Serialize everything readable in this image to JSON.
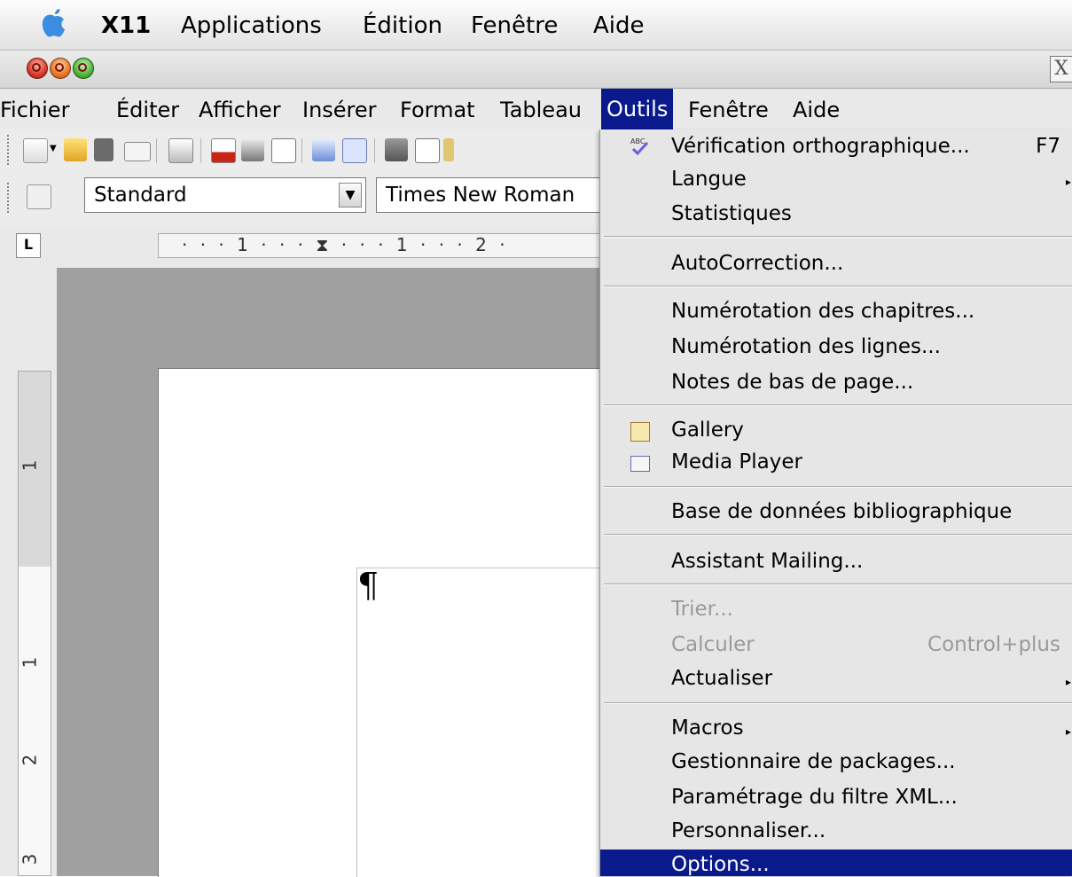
{
  "mac_menubar": {
    "items": [
      "X11",
      "Applications",
      "Édition",
      "Fenêtre",
      "Aide"
    ]
  },
  "window": {
    "close_glyph": "X"
  },
  "app_menubar": {
    "items": [
      "Fichier",
      "Éditer",
      "Afficher",
      "Insérer",
      "Format",
      "Tableau",
      "Outils",
      "Fenêtre",
      "Aide"
    ],
    "active": "Outils"
  },
  "toolbar2": {
    "style_value": "Standard",
    "font_value": "Times New Roman"
  },
  "ruler": {
    "corner_glyph": "L",
    "horizontal_text": "· · · 1 · · · ⧗ · · · 1 · · · 2 ·",
    "vertical_numbers": [
      "1",
      "1",
      "2",
      "3"
    ]
  },
  "document": {
    "pilcrow": "¶"
  },
  "outils_menu": {
    "items": [
      {
        "label": "Vérification orthographique...",
        "shortcut": "F7",
        "icon": "spellcheck-icon"
      },
      {
        "label": "Langue",
        "submenu": true
      },
      {
        "label": "Statistiques"
      },
      {
        "label": "AutoCorrection..."
      },
      {
        "label": "Numérotation des chapitres..."
      },
      {
        "label": "Numérotation des lignes..."
      },
      {
        "label": "Notes de bas de page..."
      },
      {
        "label": "Gallery",
        "icon": "gallery-icon"
      },
      {
        "label": "Media Player",
        "icon": "media-player-icon"
      },
      {
        "label": "Base de données bibliographique"
      },
      {
        "label": "Assistant Mailing..."
      },
      {
        "label": "Trier...",
        "disabled": true
      },
      {
        "label": "Calculer",
        "shortcut": "Control+plus",
        "disabled": true
      },
      {
        "label": "Actualiser",
        "submenu": true
      },
      {
        "label": "Macros",
        "submenu": true
      },
      {
        "label": "Gestionnaire de packages..."
      },
      {
        "label": "Paramétrage du filtre XML..."
      },
      {
        "label": "Personnaliser..."
      },
      {
        "label": "Options...",
        "highlighted": true
      }
    ]
  },
  "colors": {
    "highlight": "#0a1a8c",
    "menu_bg": "#e6e6e6",
    "disabled_text": "#9a9a9a"
  }
}
